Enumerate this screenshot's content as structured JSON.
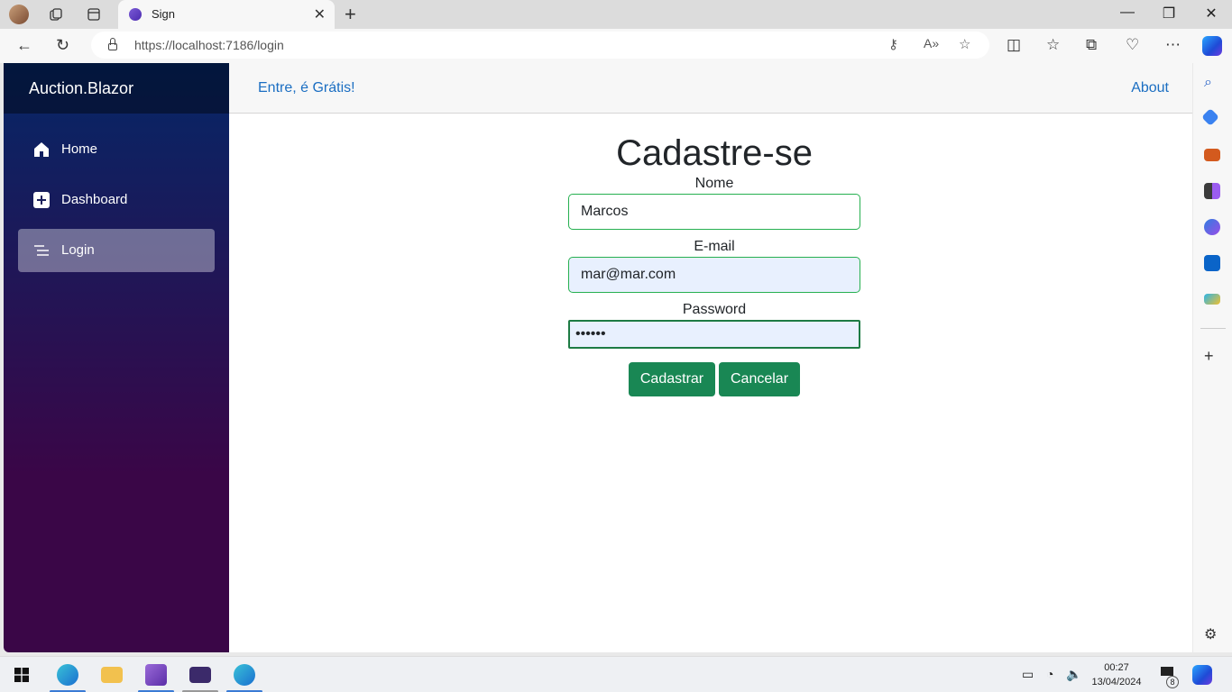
{
  "browser": {
    "tab_title": "Sign",
    "url": "https://localhost:7186/login"
  },
  "app": {
    "brand": "Auction.Blazor",
    "nav": [
      {
        "label": "Home",
        "icon": "home-icon"
      },
      {
        "label": "Dashboard",
        "icon": "plus-square-icon"
      },
      {
        "label": "Login",
        "icon": "list-icon",
        "active": true
      }
    ],
    "top_left_link": "Entre, é Grátis!",
    "top_right_link": "About"
  },
  "form": {
    "title": "Cadastre-se",
    "name_label": "Nome",
    "name_value": "Marcos",
    "email_label": "E-mail",
    "email_value": "mar@mar.com",
    "password_label": "Password",
    "password_value": "••••••",
    "submit_label": "Cadastrar",
    "cancel_label": "Cancelar"
  },
  "taskbar": {
    "time": "00:27",
    "date": "13/04/2024",
    "notification_count": "8"
  },
  "colors": {
    "sidebar_top": "#052767",
    "sidebar_bottom": "#3a0647",
    "link": "#1b6ec2",
    "button": "#198754"
  }
}
